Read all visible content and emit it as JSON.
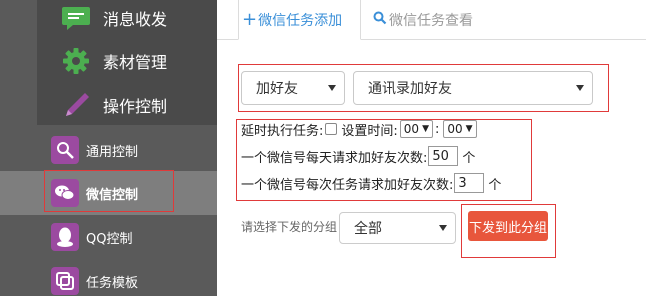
{
  "sidebar": {
    "big_items": [
      {
        "label": "消息收发",
        "icon": "chat-bubble-icon"
      },
      {
        "label": "素材管理",
        "icon": "gear-icon"
      },
      {
        "label": "操作控制",
        "icon": "pen-icon"
      }
    ],
    "items": [
      {
        "label": "通用控制",
        "icon": "settings-wand-icon"
      },
      {
        "label": "微信控制",
        "icon": "wechat-icon"
      },
      {
        "label": "QQ控制",
        "icon": "qq-penguin-icon"
      },
      {
        "label": "任务模板",
        "icon": "template-icon"
      }
    ],
    "active_item": "微信控制"
  },
  "tabs": {
    "add": {
      "label": "微信任务添加",
      "icon": "plus-icon"
    },
    "view": {
      "label": "微信任务查看",
      "icon": "search-icon"
    }
  },
  "task_type": {
    "value": "加好友"
  },
  "task_subtype": {
    "value": "通讯录加好友"
  },
  "delay": {
    "label": "延时执行任务:",
    "checkbox_label": "设置时间:",
    "hour": "00",
    "minute": "00",
    "separator": ":"
  },
  "daily": {
    "label": "一个微信号每天请求加好友次数:",
    "value": "50",
    "unit": "个"
  },
  "per_task": {
    "label": "一个微信号每次任务请求加好友次数:",
    "value": "3",
    "unit": "个"
  },
  "group": {
    "hint": "请选择下发的分组",
    "value": "全部"
  },
  "submit": {
    "label": "下发到此分组"
  },
  "colors": {
    "accent": "#3a8fd8",
    "sidebar": "#5a5a5a",
    "highlight_box": "#e03a3a",
    "button": "#e8563c"
  }
}
